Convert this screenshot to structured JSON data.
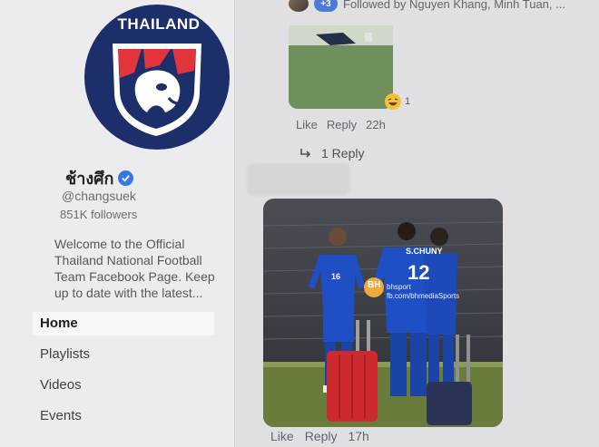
{
  "sidebar": {
    "logo_text": "THAILAND",
    "page_name": "ช้างศึก",
    "handle": "@changsuek",
    "followers": "851K followers",
    "about": "Welcome to the Official Thailand National Football Team Facebook Page. Keep up to date with the latest...",
    "nav": [
      {
        "label": "Home",
        "active": true
      },
      {
        "label": "Playlists"
      },
      {
        "label": "Videos"
      },
      {
        "label": "Events"
      }
    ]
  },
  "feed": {
    "followed_badge": "+3",
    "followed_text": "Followed by Nguyen Khang, Minh Tuan, ...",
    "comment": {
      "reaction_count": "1",
      "like": "Like",
      "reply": "Reply",
      "time": "22h",
      "replies_link": "1 Reply"
    },
    "post": {
      "watermark_badge": "BH",
      "watermark_text": "bhsport\nfb.com/bhmediaSports",
      "jersey_left": "16",
      "jersey_center": "12",
      "jersey_name": "S.CHUNY",
      "like": "Like",
      "reply": "Reply",
      "time": "17h"
    }
  },
  "colors": {
    "logo_navy": "#1d2f6b",
    "logo_red": "#e4343b",
    "verified_blue": "#3578e5",
    "jersey_blue": "#1f4fc4",
    "suitcase_red": "#cc2a2e",
    "suitcase_navy": "#2b3356"
  }
}
